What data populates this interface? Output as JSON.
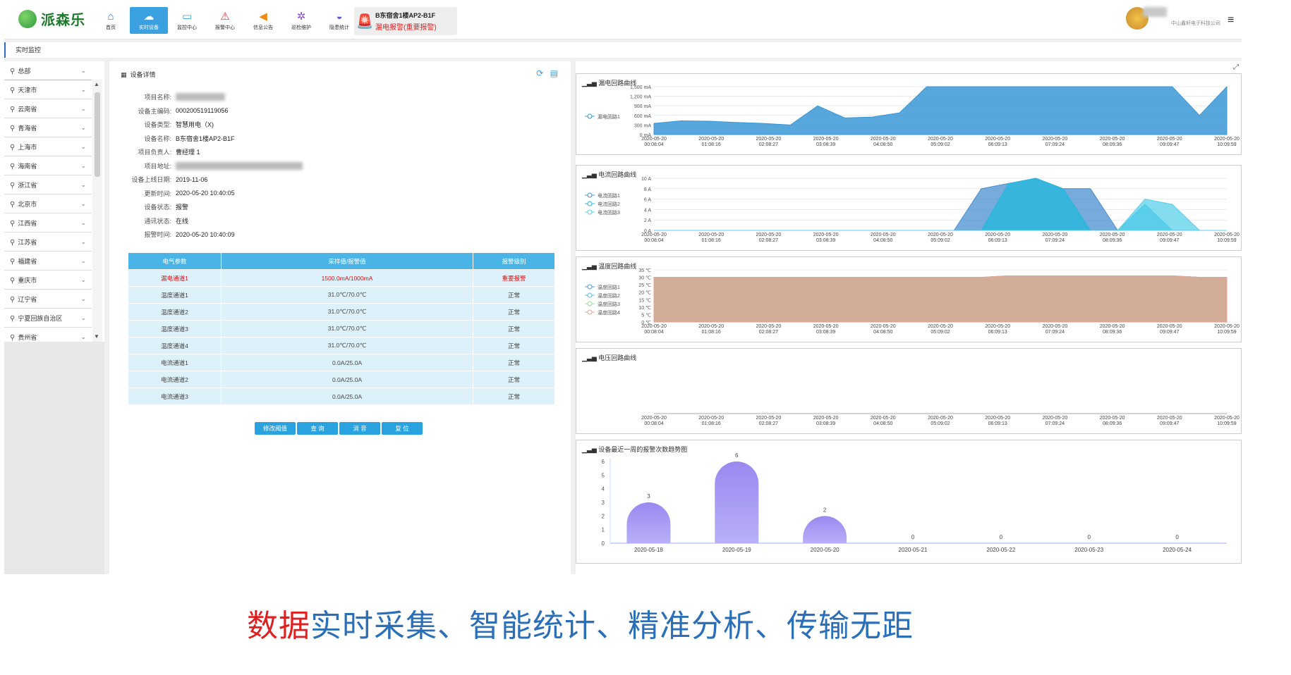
{
  "brand": {
    "name": "派森乐"
  },
  "nav": [
    {
      "label": "首页",
      "icon": "home-icon",
      "glyph": "⌂"
    },
    {
      "label": "实时设备",
      "icon": "cloud-icon",
      "glyph": "☁"
    },
    {
      "label": "监控中心",
      "icon": "monitor-icon",
      "glyph": "▭"
    },
    {
      "label": "报警中心",
      "icon": "siren-icon",
      "glyph": "⚠"
    },
    {
      "label": "信息公告",
      "icon": "megaphone-icon",
      "glyph": "◀"
    },
    {
      "label": "巡检维护",
      "icon": "gear-icon",
      "glyph": "✲"
    },
    {
      "label": "隐患统计",
      "icon": "chart-icon",
      "glyph": "◒"
    }
  ],
  "alarm": {
    "device": "B东宿舍1楼AP2-B1F",
    "message": "漏电报警(重要报警)"
  },
  "user": {
    "company": "中山鑫轩电子科技公司"
  },
  "breadcrumb": "实时监控",
  "sidebar": {
    "root": "总部",
    "items": [
      "天津市",
      "云南省",
      "青海省",
      "上海市",
      "海南省",
      "浙江省",
      "北京市",
      "江西省",
      "江苏省",
      "福建省",
      "重庆市",
      "辽宁省",
      "宁夏回族自治区",
      "贵州省"
    ]
  },
  "detail": {
    "title": "设备详情",
    "fields": [
      {
        "k": "项目名称:",
        "v": "",
        "blur": 70
      },
      {
        "k": "设备主编码:",
        "v": "000200519119056"
      },
      {
        "k": "设备类型:",
        "v": "智慧用电（X)"
      },
      {
        "k": "设备名称:",
        "v": "B东宿舍1楼AP2-B1F"
      },
      {
        "k": "项目负责人:",
        "v": "曹经理 1"
      },
      {
        "k": "项目地址:",
        "v": "",
        "blur": 180
      },
      {
        "k": "设备上线日期:",
        "v": "2019-11-06"
      },
      {
        "k": "更新时间:",
        "v": "2020-05-20 10:40:05"
      },
      {
        "k": "设备状态:",
        "v": "报警"
      },
      {
        "k": "通讯状态:",
        "v": "在线"
      },
      {
        "k": "报警时间:",
        "v": "2020-05-20 10:40:09"
      }
    ],
    "table": {
      "headers": [
        "电气参数",
        "采样值/报警值",
        "报警级别"
      ],
      "rows": [
        {
          "name": "漏电通道1",
          "value": "1500.0mA/1000mA",
          "level": "重要报警",
          "alert": true
        },
        {
          "name": "温度通道1",
          "value": "31.0℃/70.0℃",
          "level": "正常"
        },
        {
          "name": "温度通道2",
          "value": "31.0℃/70.0℃",
          "level": "正常"
        },
        {
          "name": "温度通道3",
          "value": "31.0℃/70.0℃",
          "level": "正常"
        },
        {
          "name": "温度通道4",
          "value": "31.0℃/70.0℃",
          "level": "正常"
        },
        {
          "name": "电流通道1",
          "value": "0.0A/25.0A",
          "level": "正常"
        },
        {
          "name": "电流通道2",
          "value": "0.0A/25.0A",
          "level": "正常"
        },
        {
          "name": "电流通道3",
          "value": "0.0A/25.0A",
          "level": "正常"
        }
      ]
    },
    "buttons": [
      "修改阈值",
      "查 询",
      "消 音",
      "复 位"
    ]
  },
  "chart_data": [
    {
      "type": "area",
      "title": "漏电回路曲线",
      "x": [
        "2020-05-20 00:08:04",
        "2020-05-20 01:08:16",
        "2020-05-20 02:08:27",
        "2020-05-20 03:08:39",
        "2020-05-20 04:08:50",
        "2020-05-20 05:09:02",
        "2020-05-20 06:09:13",
        "2020-05-20 07:09:24",
        "2020-05-20 08:09:36",
        "2020-05-20 09:09:47",
        "2020-05-20 10:09:59"
      ],
      "yticks": [
        "0 mA",
        "300 mA",
        "600 mA",
        "900 mA",
        "1,200 mA",
        "1,500 mA"
      ],
      "ylim": [
        0,
        1500
      ],
      "series": [
        {
          "name": "漏电回路1",
          "color": "#3a98d6",
          "values": [
            350,
            430,
            420,
            380,
            350,
            300,
            900,
            520,
            550,
            680,
            1500,
            1500,
            1500,
            1500,
            1500,
            1500,
            1500,
            1500,
            1500,
            1500,
            600,
            1500
          ]
        }
      ]
    },
    {
      "type": "area",
      "title": "电流回路曲线",
      "x": [
        "2020-05-20 00:08:04",
        "2020-05-20 01:08:16",
        "2020-05-20 02:08:27",
        "2020-05-20 03:08:39",
        "2020-05-20 04:08:50",
        "2020-05-20 05:09:02",
        "2020-05-20 06:09:13",
        "2020-05-20 07:09:24",
        "2020-05-20 08:09:36",
        "2020-05-20 09:09:47",
        "2020-05-20 10:09:59"
      ],
      "yticks": [
        "0 A",
        "2 A",
        "4 A",
        "6 A",
        "8 A",
        "10 A"
      ],
      "ylim": [
        0,
        10
      ],
      "series": [
        {
          "name": "电流回路1",
          "color": "#4a8fd0",
          "values": [
            0,
            0,
            0,
            0,
            0,
            0,
            0,
            0,
            0,
            0,
            0,
            0,
            8,
            9,
            10,
            8,
            8,
            0,
            0,
            0,
            0,
            0
          ]
        },
        {
          "name": "电流回路2",
          "color": "#22b8de",
          "values": [
            0,
            0,
            0,
            0,
            0,
            0,
            0,
            0,
            0,
            0,
            0,
            0,
            0,
            9,
            10,
            8,
            0,
            0,
            5,
            0,
            0,
            0
          ]
        },
        {
          "name": "电流回路3",
          "color": "#5cd0ea",
          "values": [
            0,
            0,
            0,
            0,
            0,
            0,
            0,
            0,
            0,
            0,
            0,
            0,
            0,
            0,
            0,
            0,
            0,
            0,
            6,
            5,
            0,
            0
          ]
        }
      ]
    },
    {
      "type": "area",
      "title": "温度回路曲线",
      "x": [
        "2020-05-20 00:08:04",
        "2020-05-20 01:08:16",
        "2020-05-20 02:08:27",
        "2020-05-20 03:08:39",
        "2020-05-20 04:08:50",
        "2020-05-20 05:09:02",
        "2020-05-20 06:09:13",
        "2020-05-20 07:09:24",
        "2020-05-20 08:09:36",
        "2020-05-20 09:09:47",
        "2020-05-20 10:09:59"
      ],
      "yticks": [
        "0 ℃",
        "5 ℃",
        "10 ℃",
        "15 ℃",
        "20 ℃",
        "25 ℃",
        "30 ℃",
        "35 ℃"
      ],
      "ylim": [
        0,
        35
      ],
      "series": [
        {
          "name": "温度回路1",
          "color": "#4aa0d8",
          "values": [
            30,
            30,
            30,
            30,
            30,
            30,
            30,
            30,
            30,
            30,
            30,
            30,
            30,
            31,
            31,
            31,
            31,
            31,
            31,
            31,
            30,
            30
          ]
        },
        {
          "name": "温度回路2",
          "color": "#50c0e0",
          "values": [
            30,
            30,
            30,
            30,
            30,
            30,
            30,
            30,
            30,
            30,
            30,
            30,
            30,
            31,
            31,
            31,
            31,
            31,
            31,
            31,
            30,
            30
          ]
        },
        {
          "name": "温度回路3",
          "color": "#9fd8a0",
          "values": [
            30,
            30,
            30,
            30,
            30,
            30,
            30,
            30,
            30,
            30,
            30,
            30,
            30,
            31,
            31,
            31,
            31,
            31,
            31,
            31,
            30,
            30
          ]
        },
        {
          "name": "温度回路4",
          "color": "#e8a090",
          "values": [
            30,
            30,
            30,
            30,
            30,
            30,
            30,
            30,
            30,
            30,
            30,
            30,
            30,
            31,
            31,
            31,
            31,
            31,
            31,
            31,
            30,
            30
          ]
        }
      ]
    },
    {
      "type": "line",
      "title": "电压回路曲线",
      "x": [
        "2020-05-20 00:08:04",
        "2020-05-20 01:08:16",
        "2020-05-20 02:08:27",
        "2020-05-20 03:08:39",
        "2020-05-20 04:08:50",
        "2020-05-20 05:09:02",
        "2020-05-20 06:09:13",
        "2020-05-20 07:09:24",
        "2020-05-20 08:09:36",
        "2020-05-20 09:09:47",
        "2020-05-20 10:09:59"
      ],
      "series": []
    },
    {
      "type": "bar",
      "title": "设备最近一周的报警次数趋势图",
      "categories": [
        "2020-05-18",
        "2020-05-19",
        "2020-05-20",
        "2020-05-21",
        "2020-05-22",
        "2020-05-23",
        "2020-05-24"
      ],
      "values": [
        3,
        6,
        2,
        0,
        0,
        0,
        0
      ],
      "ylim": [
        0,
        6
      ],
      "yticks": [
        "0",
        "1",
        "2",
        "3",
        "4",
        "5",
        "6"
      ]
    }
  ],
  "caption": {
    "highlight": "数据",
    "rest": "实时采集、智能统计、精准分析、传输无距"
  }
}
